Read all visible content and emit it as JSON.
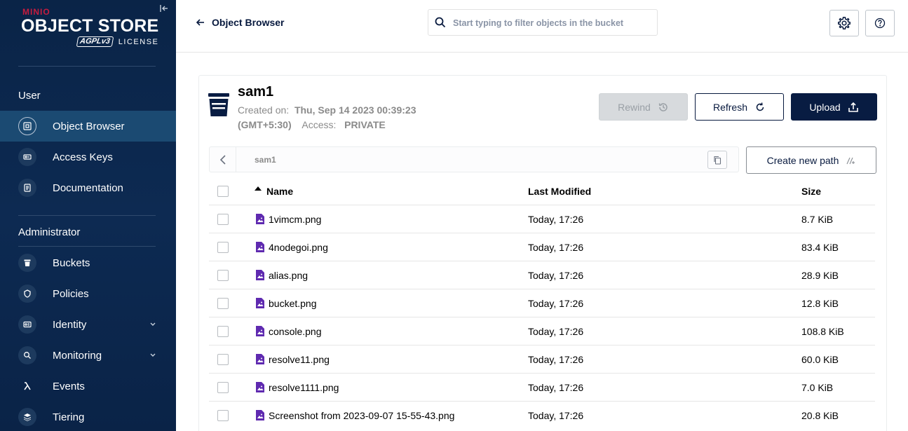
{
  "sidebar": {
    "logo": {
      "brand": "MINIO",
      "product": "OBJECT STORE",
      "badge": "AGPLv3",
      "license": "LICENSE"
    },
    "user_section": "User",
    "admin_section": "Administrator",
    "user_items": [
      {
        "label": "Object Browser",
        "icon": "object-browser-icon",
        "active": true
      },
      {
        "label": "Access Keys",
        "icon": "key-icon"
      },
      {
        "label": "Documentation",
        "icon": "document-icon"
      }
    ],
    "admin_items": [
      {
        "label": "Buckets",
        "icon": "bucket-icon"
      },
      {
        "label": "Policies",
        "icon": "policy-icon"
      },
      {
        "label": "Identity",
        "icon": "identity-icon",
        "expandable": true
      },
      {
        "label": "Monitoring",
        "icon": "monitoring-icon",
        "expandable": true
      },
      {
        "label": "Events",
        "icon": "lambda-icon"
      },
      {
        "label": "Tiering",
        "icon": "tiering-icon"
      }
    ]
  },
  "header": {
    "back_label": "Object Browser",
    "search_placeholder": "Start typing to filter objects in the bucket"
  },
  "bucket": {
    "name": "sam1",
    "created_label": "Created on:",
    "created_value": "Thu, Sep 14 2023 00:39:23",
    "timezone": "(GMT+5:30)",
    "access_label": "Access:",
    "access_value": "PRIVATE"
  },
  "actions": {
    "rewind": "Rewind",
    "refresh": "Refresh",
    "upload": "Upload",
    "create_path": "Create new path"
  },
  "breadcrumb": {
    "path": "sam1"
  },
  "table": {
    "columns": {
      "name": "Name",
      "modified": "Last Modified",
      "size": "Size"
    },
    "rows": [
      {
        "name": "1vimcm.png",
        "modified": "Today, 17:26",
        "size": "8.7 KiB"
      },
      {
        "name": "4nodegoi.png",
        "modified": "Today, 17:26",
        "size": "83.4 KiB"
      },
      {
        "name": "alias.png",
        "modified": "Today, 17:26",
        "size": "28.9 KiB"
      },
      {
        "name": "bucket.png",
        "modified": "Today, 17:26",
        "size": "12.8 KiB"
      },
      {
        "name": "console.png",
        "modified": "Today, 17:26",
        "size": "108.8 KiB"
      },
      {
        "name": "resolve11.png",
        "modified": "Today, 17:26",
        "size": "60.0 KiB"
      },
      {
        "name": "resolve1111.png",
        "modified": "Today, 17:26",
        "size": "7.0 KiB"
      },
      {
        "name": "Screenshot from 2023-09-07 15-55-43.png",
        "modified": "Today, 17:26",
        "size": "20.8 KiB"
      }
    ]
  },
  "colors": {
    "sidebar_bg": "#0a2447",
    "active_item": "#1b4a72",
    "primary": "#081c42",
    "file_icon": "#5f2ab0",
    "brand_red": "#c51c3f"
  }
}
